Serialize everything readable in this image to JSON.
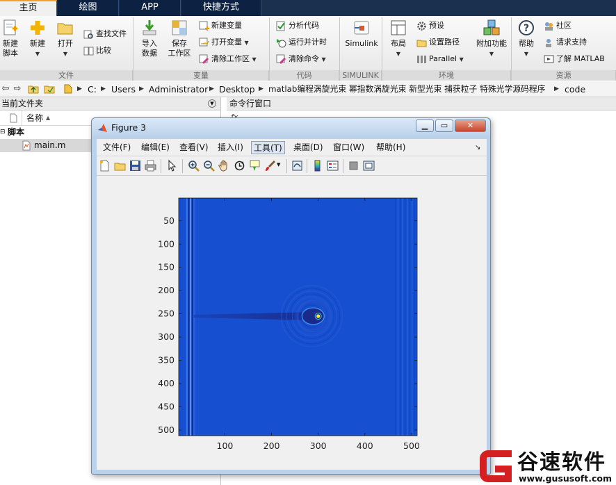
{
  "tabs": [
    "主页",
    "绘图",
    "APP",
    "快捷方式"
  ],
  "ribbon": {
    "file_group": {
      "label": "文件",
      "new_script": "新建\n脚本",
      "new": "新建",
      "open": "打开",
      "find_files": "查找文件",
      "compare": "比较"
    },
    "variable_group": {
      "label": "变量",
      "import_data": "导入\n数据",
      "save_workspace": "保存\n工作区",
      "new_variable": "新建变量",
      "open_variable": "打开变量",
      "clear_workspace": "清除工作区"
    },
    "code_group": {
      "label": "代码",
      "analyze_code": "分析代码",
      "run_and_time": "运行并计时",
      "clear_commands": "清除命令"
    },
    "simulink_group": {
      "label": "SIMULINK",
      "simulink": "Simulink"
    },
    "environment_group": {
      "label": "环境",
      "layout": "布局",
      "preferences": "预设",
      "set_path": "设置路径",
      "parallel": "Parallel",
      "add_ons": "附加功能"
    },
    "resources_group": {
      "label": "资源",
      "help": "帮助",
      "community": "社区",
      "request_support": "请求支持",
      "learn_matlab": "了解 MATLAB"
    }
  },
  "address": {
    "path": [
      "C:",
      "Users",
      "Administrator",
      "Desktop",
      "matlab编程涡旋光束 幂指数涡旋光束 新型光束 捕获粒子 特殊光学源码程序",
      "code"
    ]
  },
  "current_folder": {
    "title": "当前文件夹",
    "column_name": "名称",
    "column_sort": "▲",
    "group": "脚本",
    "files": [
      "main.m"
    ]
  },
  "command_window": {
    "title": "命令行窗口",
    "prompt": "fx"
  },
  "figure": {
    "title": "Figure 3",
    "menus": [
      "文件(F)",
      "编辑(E)",
      "查看(V)",
      "插入(I)",
      "工具(T)",
      "桌面(D)",
      "窗口(W)",
      "帮助(H)"
    ],
    "selected_menu": "工具(T)",
    "dock_arrow": "↘"
  },
  "chart_data": {
    "type": "heatmap",
    "title": "",
    "xlabel": "",
    "ylabel": "",
    "x_ticks": [
      100,
      200,
      300,
      400,
      500
    ],
    "y_ticks": [
      50,
      100,
      150,
      200,
      250,
      300,
      350,
      400,
      450,
      500
    ],
    "xlim": [
      1,
      512
    ],
    "ylim": [
      1,
      512
    ],
    "y_direction": "reverse",
    "colormap": "parula",
    "background_color": "#1650d0",
    "features": {
      "left_fringe_x": [
        20,
        35
      ],
      "right_fringe_x": [
        465,
        510
      ],
      "beam_tail": {
        "x_from": 30,
        "x_to": 290,
        "y": 255
      },
      "beam_head": {
        "x": 295,
        "y": 255
      },
      "bright_spot": {
        "x": 300,
        "y": 255
      }
    }
  },
  "watermark": {
    "brand": "谷速软件",
    "url": "www.gususoft.com"
  },
  "colors": {
    "tab_bar": "#1b2f4f",
    "tab_active_border": "#f0a030",
    "figure_frame": "#b9d1ea",
    "plot_bg": "#1650d0",
    "watermark_red": "#d42020"
  }
}
